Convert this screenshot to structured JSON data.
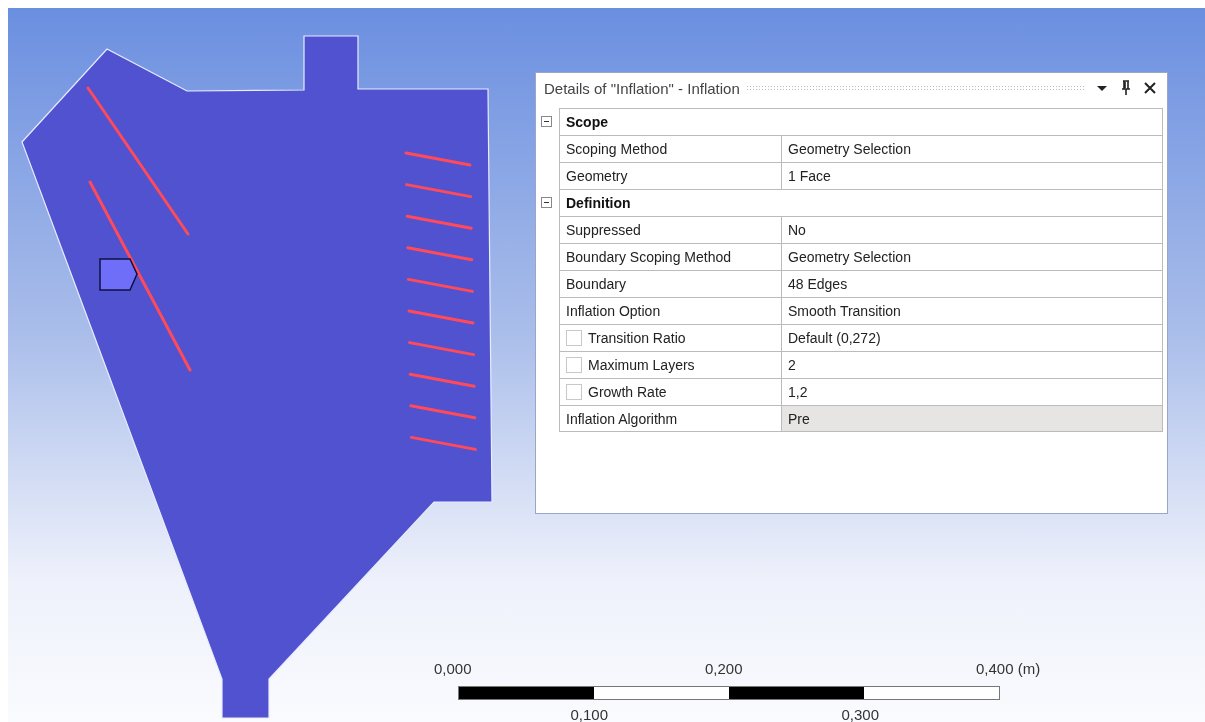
{
  "details_panel": {
    "title": "Details of \"Inflation\" - Inflation",
    "sections": [
      {
        "label": "Scope",
        "expanded": true,
        "rows": [
          {
            "kind": "plain",
            "label": "Scoping Method",
            "value": "Geometry Selection",
            "highlighted": false
          },
          {
            "kind": "plain",
            "label": "Geometry",
            "value": "1 Face",
            "highlighted": false
          }
        ]
      },
      {
        "label": "Definition",
        "expanded": true,
        "rows": [
          {
            "kind": "plain",
            "label": "Suppressed",
            "value": "No",
            "highlighted": false
          },
          {
            "kind": "plain",
            "label": "Boundary Scoping Method",
            "value": "Geometry Selection",
            "highlighted": false
          },
          {
            "kind": "plain",
            "label": "Boundary",
            "value": "48 Edges",
            "highlighted": false
          },
          {
            "kind": "plain",
            "label": "Inflation Option",
            "value": "Smooth Transition",
            "highlighted": false
          },
          {
            "kind": "checkbox",
            "checked": false,
            "label": "Transition Ratio",
            "value": "Default (0,272)",
            "highlighted": false
          },
          {
            "kind": "checkbox",
            "checked": false,
            "label": "Maximum Layers",
            "value": "2",
            "highlighted": false
          },
          {
            "kind": "checkbox",
            "checked": false,
            "label": "Growth Rate",
            "value": "1,2",
            "highlighted": false
          },
          {
            "kind": "plain",
            "label": "Inflation Algorithm",
            "value": "Pre",
            "highlighted": true
          }
        ]
      }
    ]
  },
  "scale_bar": {
    "top_labels": [
      "0,000",
      "0,200",
      "0,400 (m)"
    ],
    "bottom_labels": [
      "0,100",
      "0,300"
    ]
  }
}
